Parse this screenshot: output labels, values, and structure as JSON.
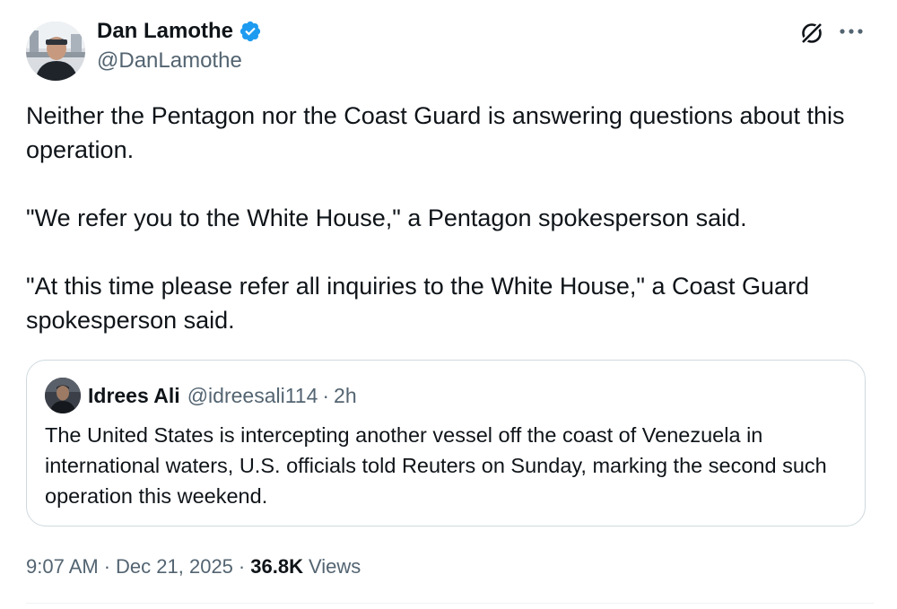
{
  "author": {
    "name": "Dan Lamothe",
    "handle": "@DanLamothe",
    "verified_color": "#1d9bf0"
  },
  "header_icons": {
    "grok": "grok-icon",
    "more": "more-options-icon"
  },
  "tweet": {
    "paragraphs": [
      "Neither the Pentagon nor the Coast Guard is answering questions about this operation.",
      "\"We refer you to the White House,\" a Pentagon spokesperson said.",
      "\"At this time please refer all inquiries to the White House,\" a Coast Guard spokesperson said."
    ]
  },
  "quote": {
    "name": "Idrees Ali",
    "handle": "@idreesali114",
    "separator": "·",
    "time": "2h",
    "text": "The United States is  intercepting another vessel off the coast of Venezuela in international waters, U.S. officials told Reuters on Sunday, marking the second such operation this weekend."
  },
  "meta": {
    "time": "9:07 AM",
    "separator": "·",
    "date": "Dec 21, 2025",
    "views_count": "36.8K",
    "views_label": "Views"
  },
  "colors": {
    "text_primary": "#0f1419",
    "text_secondary": "#536471",
    "border": "#cfd9de",
    "accent": "#1d9bf0"
  }
}
